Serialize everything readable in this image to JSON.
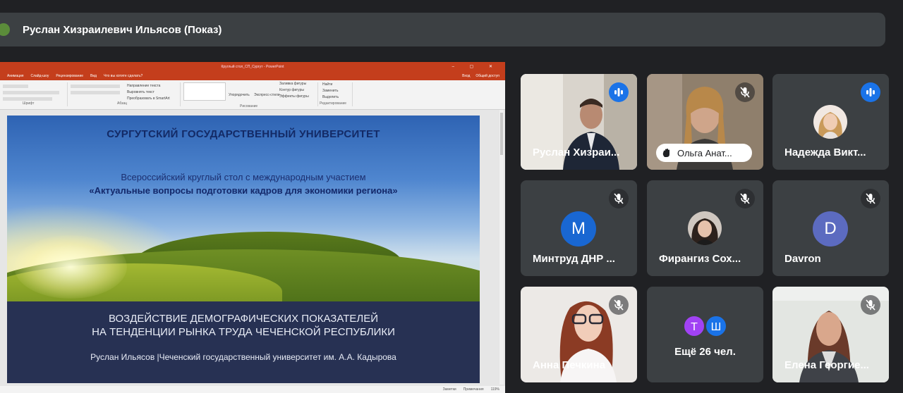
{
  "banner": {
    "title": "Руслан Хизраилевич Ильясов (Показ)"
  },
  "powerpoint": {
    "window_title": "Круглый стол_СП_Сургут - PowerPoint",
    "tabs": [
      "Анимация",
      "Слайд-шоу",
      "Рецензирование",
      "Вид",
      "Что вы хотите сделать?"
    ],
    "tabs_right": [
      "Вход",
      "Общий доступ"
    ],
    "ribbon_groups": [
      "Шрифт",
      "Абзац",
      "Рисование",
      "Редактирование"
    ],
    "ribbon_items": {
      "text_direction": "Направление текста",
      "align_text": "Выровнять текст",
      "smartart": "Преобразовать в SmartArt",
      "arrange": "Упорядочить",
      "quick_styles": "Экспресс-стили",
      "shape_fill": "Заливка фигуры",
      "shape_outline": "Контур фигуры",
      "shape_effects": "Эффекты фигуры",
      "find": "Найти",
      "replace": "Заменить",
      "select": "Выделить"
    },
    "status": {
      "notes": "Заметки",
      "comments": "Примечания",
      "zoom": "119%"
    }
  },
  "slide": {
    "university": "СУРГУТСКИЙ ГОСУДАРСТВЕННЫЙ УНИВЕРСИТЕТ",
    "event": "Всероссийский круглый стол с международным участием",
    "event_title": "«Актуальные вопросы подготовки кадров для экономики региона»",
    "talk_line1": "ВОЗДЕЙСТВИЕ ДЕМОГРАФИЧЕСКИХ ПОКАЗАТЕЛЕЙ",
    "talk_line2": "НА ТЕНДЕНЦИИ РЫНКА ТРУДА ЧЕЧЕНСКОЙ РЕСПУБЛИКИ",
    "author": "Руслан Ильясов |Чеченский государственный университет им. А.А. Кадырова"
  },
  "participants": [
    {
      "name": "Руслан Хизраи...",
      "mic": "speaking",
      "type": "video"
    },
    {
      "name": "Ольга Анат...",
      "mic": "muted",
      "type": "video",
      "hand_raised": true
    },
    {
      "name": "Надежда Викт...",
      "mic": "speaking",
      "type": "photo"
    },
    {
      "name": "Минтруд ДНР ...",
      "mic": "muted",
      "type": "letter",
      "initial": "M",
      "color": "#1967d2"
    },
    {
      "name": "Фирангиз Сох...",
      "mic": "muted",
      "type": "photo"
    },
    {
      "name": "Davron",
      "mic": "muted",
      "type": "letter",
      "initial": "D",
      "color": "#5c6bc0"
    },
    {
      "name": "Анна Печкина",
      "mic": "muted",
      "type": "video"
    },
    {
      "name": "Ещё 26 чел.",
      "type": "more",
      "initials": [
        "Т",
        "Ш"
      ],
      "colors": [
        "#a142f4",
        "#1a73e8"
      ]
    },
    {
      "name": "Елена Георгие...",
      "mic": "muted",
      "type": "video"
    }
  ]
}
